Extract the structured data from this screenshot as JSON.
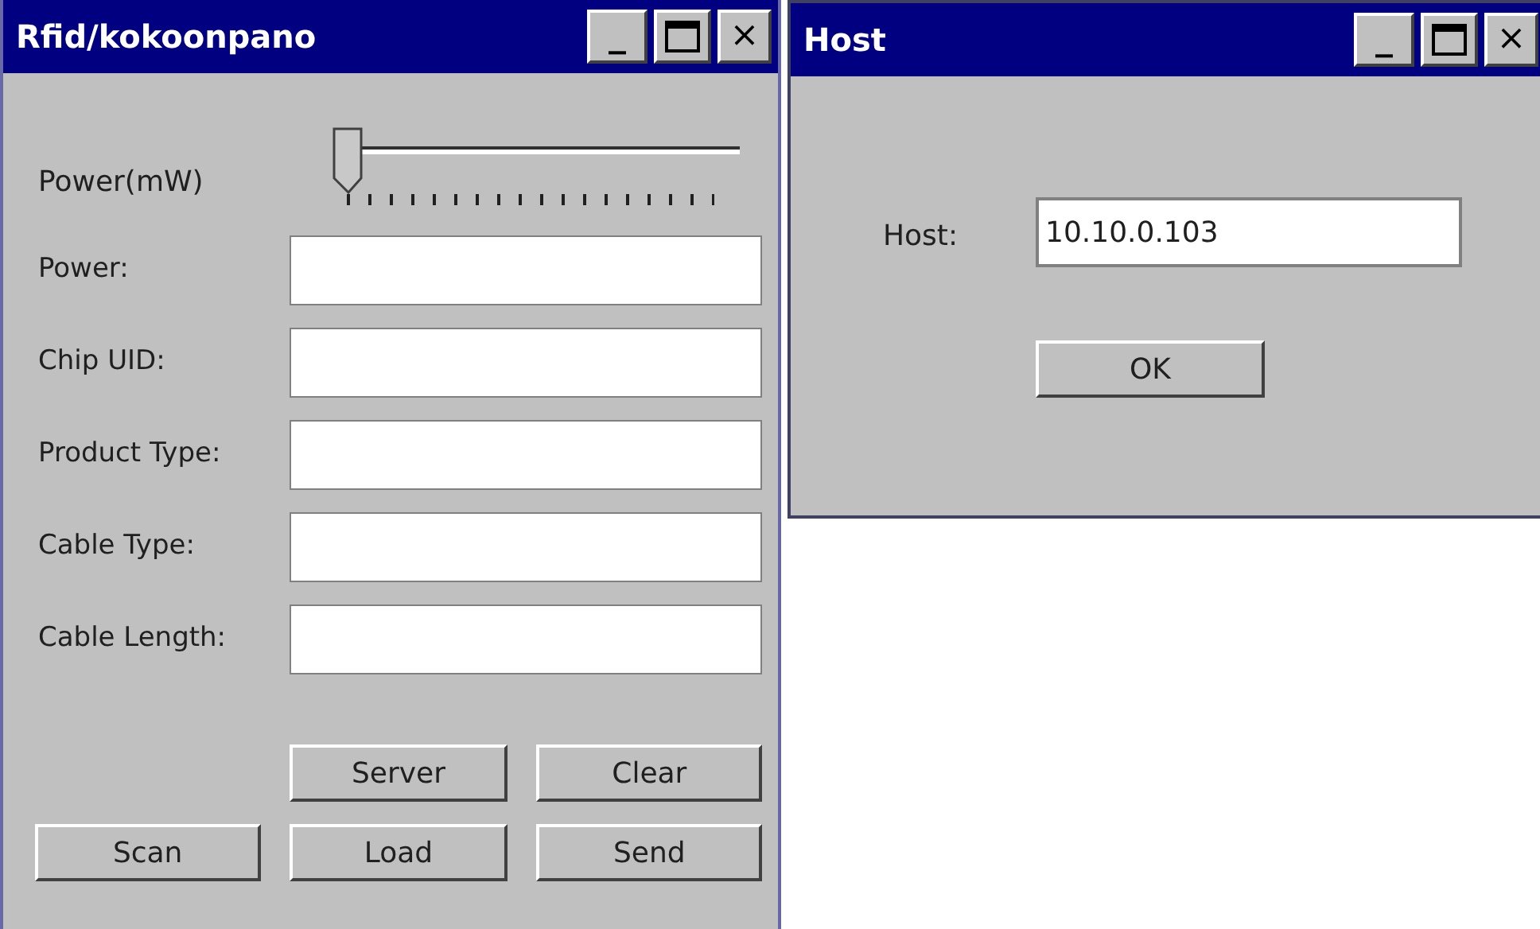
{
  "windows": [
    {
      "title": "Rfid/kokoonpano",
      "controls": [
        "_",
        "×"
      ],
      "slider": {
        "label": "Power(mW)",
        "level": 0
      },
      "fields": [
        {
          "label": "Power:"
        },
        {
          "label": "Chip UID:"
        },
        {
          "label": "Product Type:"
        },
        {
          "label": "Cable Type:"
        },
        {
          "label": "Cable Length:"
        }
      ],
      "button_rows": [
        [
          null,
          "Server",
          "Clear"
        ],
        [
          "Scan",
          "Load",
          "Send"
        ]
      ]
    },
    {
      "title": "Host",
      "controls": [
        "_",
        "×"
      ],
      "fields": [
        {
          "label": "Host:",
          "value": "10.10.0.103"
        }
      ],
      "button_rows": [
        [
          "OK"
        ]
      ]
    }
  ]
}
